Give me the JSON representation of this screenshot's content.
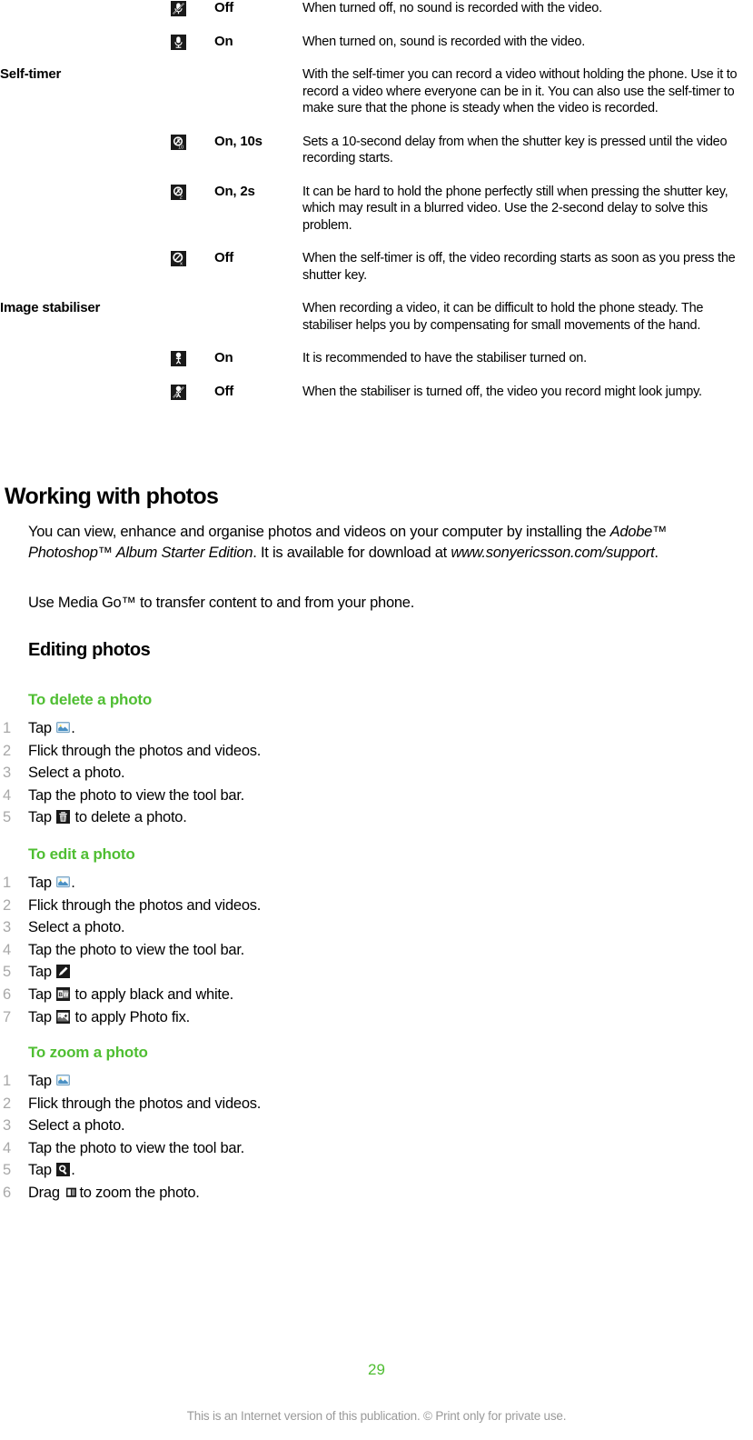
{
  "document": {
    "page_number": "29",
    "footer_note": "This is an Internet version of this publication. © Print only for private use.",
    "accent_green": "#4fbe32",
    "number_gray": "#a8a8a8",
    "footer_gray": "#9a9a9a"
  },
  "settings_table": {
    "rows": [
      {
        "setting": "",
        "icon": "microphone-off-icon",
        "option": "Off",
        "description": "When turned off, no sound is recorded with the video."
      },
      {
        "setting": "",
        "icon": "microphone-on-icon",
        "option": "On",
        "description": "When turned on, sound is recorded with the video."
      },
      {
        "setting": "Self-timer",
        "icon": "",
        "option": "",
        "description": "With the self-timer you can record a video without holding the phone. Use it to record a video where everyone can be in it. You can also use the self-timer to make sure that the phone is steady when the video is recorded."
      },
      {
        "setting": "",
        "icon": "self-timer-10s-icon",
        "option": "On, 10s",
        "description": "Sets a 10-second delay from when the shutter key is pressed until the video recording starts."
      },
      {
        "setting": "",
        "icon": "self-timer-2s-icon",
        "option": "On, 2s",
        "description": "It can be hard to hold the phone perfectly still when pressing the shutter key, which may result in a blurred video. Use the 2-second delay to solve this problem."
      },
      {
        "setting": "",
        "icon": "self-timer-off-icon",
        "option": "Off",
        "description": "When the self-timer is off, the video recording starts as soon as you press the shutter key."
      },
      {
        "setting": "Image stabiliser",
        "icon": "",
        "option": "",
        "description": "When recording a video, it can be difficult to hold the phone steady. The stabiliser helps you by compensating for small movements of the hand."
      },
      {
        "setting": "",
        "icon": "stabiliser-on-icon",
        "option": "On",
        "description": "It is recommended to have the stabiliser turned on."
      },
      {
        "setting": "",
        "icon": "stabiliser-off-icon",
        "option": "Off",
        "description": "When the stabiliser is turned off, the video you record might look jumpy."
      }
    ]
  },
  "working_with_photos": {
    "title": "Working with photos",
    "paragraph1_part1": "You can view, enhance and organise photos and videos on your computer by installing the ",
    "paragraph1_italic1": "Adobe™ Photoshop™ Album Starter Edition",
    "paragraph1_part2": ". It is available for download at ",
    "paragraph1_italic2": "www.sonyericsson.com/support",
    "paragraph1_part3": ".",
    "paragraph2": "Use Media Go™ to transfer content to and from your phone."
  },
  "editing_photos": {
    "title": "Editing photos",
    "procedures": [
      {
        "title": "To delete a photo",
        "steps": [
          {
            "pre": "Tap ",
            "icon": "gallery-icon",
            "post": "."
          },
          {
            "pre": "Flick through the photos and videos.",
            "icon": "",
            "post": ""
          },
          {
            "pre": "Select a photo.",
            "icon": "",
            "post": ""
          },
          {
            "pre": "Tap the photo to view the tool bar.",
            "icon": "",
            "post": ""
          },
          {
            "pre": "Tap ",
            "icon": "trash-icon",
            "post": " to delete a photo."
          }
        ]
      },
      {
        "title": "To edit a photo",
        "steps": [
          {
            "pre": "Tap ",
            "icon": "gallery-icon",
            "post": "."
          },
          {
            "pre": "Flick through the photos and videos.",
            "icon": "",
            "post": ""
          },
          {
            "pre": "Select a photo.",
            "icon": "",
            "post": ""
          },
          {
            "pre": "Tap the photo to view the tool bar.",
            "icon": "",
            "post": ""
          },
          {
            "pre": "Tap ",
            "icon": "pencil-icon",
            "post": ""
          },
          {
            "pre": "Tap ",
            "icon": "black-and-white-icon",
            "post": " to apply black and white."
          },
          {
            "pre": "Tap ",
            "icon": "photo-fix-icon",
            "post": " to apply Photo fix."
          }
        ]
      },
      {
        "title": "To zoom a photo",
        "steps": [
          {
            "pre": "Tap ",
            "icon": "gallery-icon",
            "post": ""
          },
          {
            "pre": "Flick through the photos and videos.",
            "icon": "",
            "post": ""
          },
          {
            "pre": "Select a photo.",
            "icon": "",
            "post": ""
          },
          {
            "pre": "Tap the photo to view the tool bar.",
            "icon": "",
            "post": ""
          },
          {
            "pre": "Tap ",
            "icon": "magnifier-icon",
            "post": "."
          },
          {
            "pre": "Drag ",
            "icon": "slider-handle-icon",
            "post": " to zoom the photo."
          }
        ]
      }
    ]
  }
}
